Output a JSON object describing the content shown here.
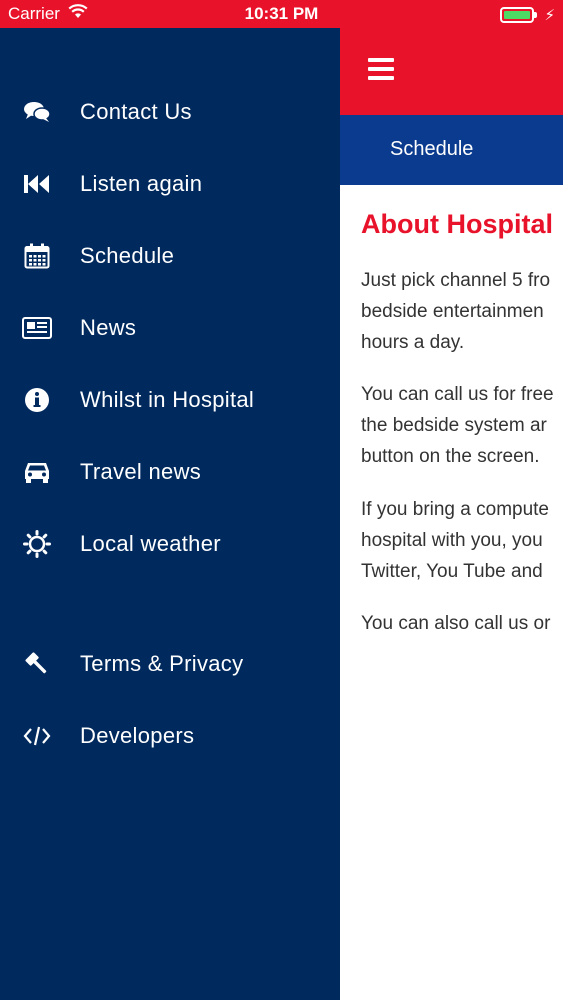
{
  "status_bar": {
    "carrier": "Carrier",
    "time": "10:31 PM"
  },
  "drawer": {
    "items": [
      {
        "label": "Contact Us",
        "icon": "chat-bubbles-icon"
      },
      {
        "label": "Listen again",
        "icon": "rewind-icon"
      },
      {
        "label": "Schedule",
        "icon": "calendar-icon"
      },
      {
        "label": "News",
        "icon": "newspaper-icon"
      },
      {
        "label": "Whilst in Hospital",
        "icon": "info-icon"
      },
      {
        "label": "Travel news",
        "icon": "car-icon"
      },
      {
        "label": "Local weather",
        "icon": "sun-icon"
      },
      {
        "label": "Terms & Privacy",
        "icon": "gavel-icon"
      },
      {
        "label": "Developers",
        "icon": "code-icon"
      }
    ]
  },
  "header": {
    "tab_label": "Schedule"
  },
  "content": {
    "title": "About Hospital",
    "paragraphs": [
      [
        "Just pick channel 5 fro",
        "bedside entertainmen",
        "hours a day."
      ],
      [
        "You can call us for free",
        "the bedside system ar",
        "button on the screen."
      ],
      [
        "If you bring a compute",
        "hospital with you, you",
        "Twitter, You Tube and"
      ],
      [
        "You can also call us or"
      ]
    ]
  },
  "colors": {
    "brand_red": "#e8122a",
    "drawer_navy": "#00295e",
    "tab_blue": "#0a3b8f",
    "battery_green": "#4cd964"
  }
}
